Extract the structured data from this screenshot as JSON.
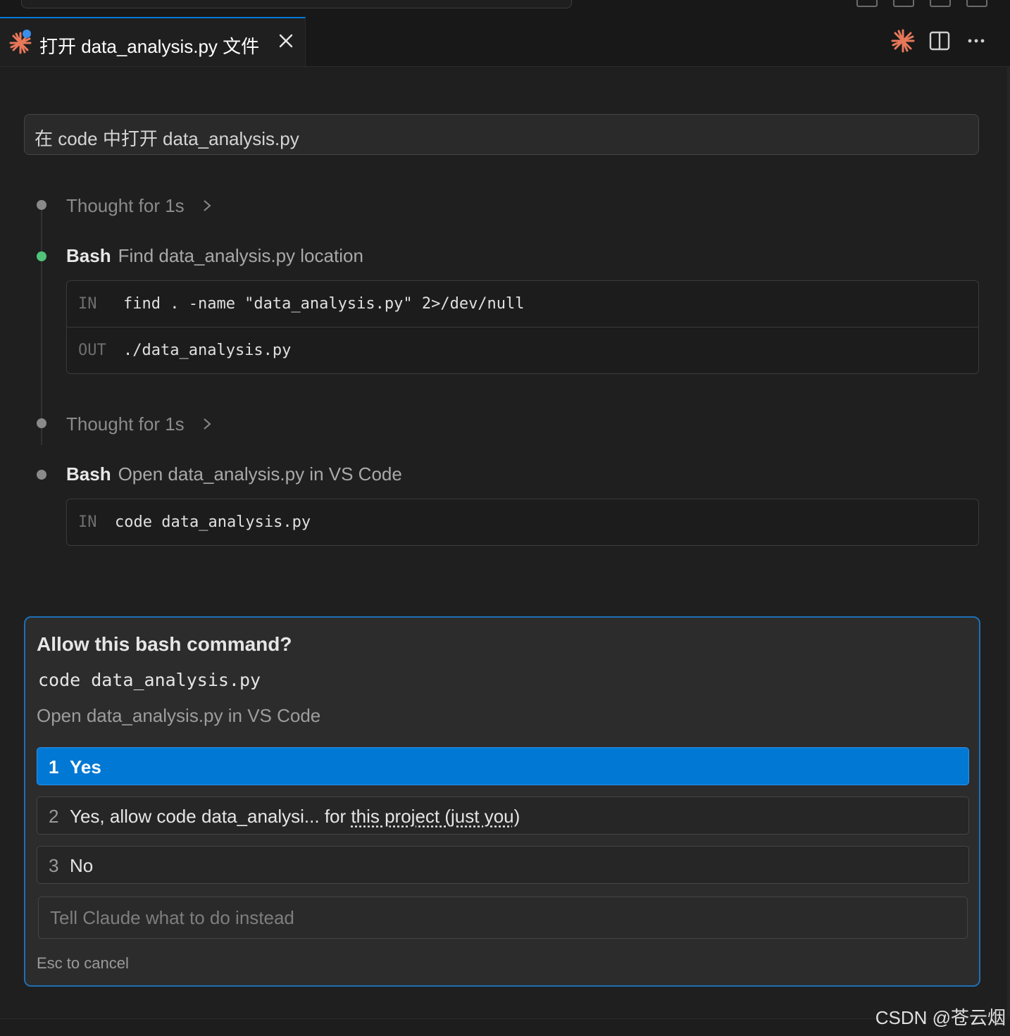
{
  "tab": {
    "title": "打开 data_analysis.py 文件"
  },
  "prompt": {
    "text": "在 code 中打开 data_analysis.py"
  },
  "timeline": [
    {
      "type": "thought",
      "label": "Thought for 1s"
    },
    {
      "type": "bash",
      "tool": "Bash",
      "description": "Find data_analysis.py location",
      "status": "success",
      "in_label": "IN",
      "in": "find . -name \"data_analysis.py\" 2>/dev/null",
      "out_label": "OUT",
      "out": "./data_analysis.py"
    },
    {
      "type": "thought",
      "label": "Thought for 1s"
    },
    {
      "type": "bash",
      "tool": "Bash",
      "description": "Open data_analysis.py in VS Code",
      "status": "pending",
      "in_label": "IN",
      "in": "code data_analysis.py"
    }
  ],
  "permission": {
    "title": "Allow this bash command?",
    "command": "code data_analysis.py",
    "description": "Open data_analysis.py in VS Code",
    "options": [
      {
        "num": "1",
        "label": "Yes",
        "selected": true
      },
      {
        "num": "2",
        "label": "Yes, allow code data_analysi... for ",
        "link": "this project (just you)"
      },
      {
        "num": "3",
        "label": "No"
      }
    ],
    "instead_placeholder": "Tell Claude what to do instead",
    "esc_hint": "Esc to cancel"
  },
  "watermark": "CSDN @苍云烟",
  "colors": {
    "accent": "#0078d4",
    "claude_orange": "#e8785a",
    "success_green": "#4fc37a"
  },
  "icons": [
    "claude-logo-icon",
    "close-icon",
    "claude-spark-icon",
    "split-editor-icon",
    "more-icon",
    "chevron-right-icon"
  ]
}
